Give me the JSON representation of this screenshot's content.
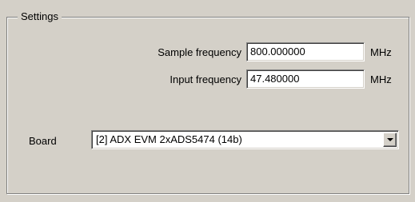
{
  "settings": {
    "title": "Settings",
    "sample_frequency": {
      "label": "Sample frequency",
      "value": "800.000000",
      "unit": "MHz"
    },
    "input_frequency": {
      "label": "Input frequency",
      "value": "47.480000",
      "unit": "MHz"
    },
    "board": {
      "label": "Board",
      "selected": "[2] ADX EVM 2xADS5474 (14b)",
      "dropdown_icon": "chevron-down-icon"
    }
  }
}
